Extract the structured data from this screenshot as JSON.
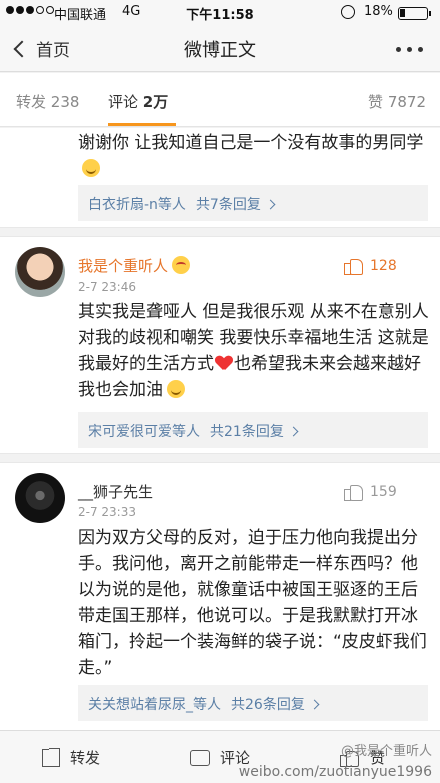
{
  "status_bar": {
    "carrier": "中国联通",
    "network": "4G",
    "time": "下午11:58",
    "battery": "18%"
  },
  "nav": {
    "back_label": "首页",
    "title": "微博正文"
  },
  "tabs": {
    "forward_label": "转发",
    "forward_count": "238",
    "comment_label": "评论",
    "comment_count": "2万",
    "like_label": "赞",
    "like_count": "7872"
  },
  "comments": [
    {
      "text": "谢谢你 让我知道自己是一个没有故事的男同学",
      "reply_users": "白衣折扇-n等人",
      "reply_count": "共7条回复"
    },
    {
      "username": "我是个重听人",
      "date": "2-7 23:46",
      "likes": "128",
      "text_a": "其实我是聋哑人 但是我很乐观 从来不在意别人对我的歧视和嘲笑    我要快乐幸福地生活 这就是我最好的生活方式",
      "text_b": "也希望我未来会越来越好 我也会加油",
      "reply_users": "宋可爱很可爱等人",
      "reply_count": "共21条回复"
    },
    {
      "username": "__狮子先生",
      "date": "2-7 23:33",
      "likes": "159",
      "text": "因为双方父母的反对，迫于压力他向我提出分手。我问他，离开之前能带走一样东西吗？他以为说的是他，就像童话中被国王驱逐的王后带走国王那样，他说可以。于是我默默打开冰箱门，拎起一个装海鲜的袋子说：“皮皮虾我们走。”",
      "reply_users": "关关想站着尿尿_等人",
      "reply_count": "共26条回复"
    }
  ],
  "bottom_bar": {
    "forward": "转发",
    "comment": "评论",
    "like": "赞"
  },
  "watermark": {
    "handle": "@我是个重听人",
    "url": "weibo.com/zuotianyue1996"
  }
}
